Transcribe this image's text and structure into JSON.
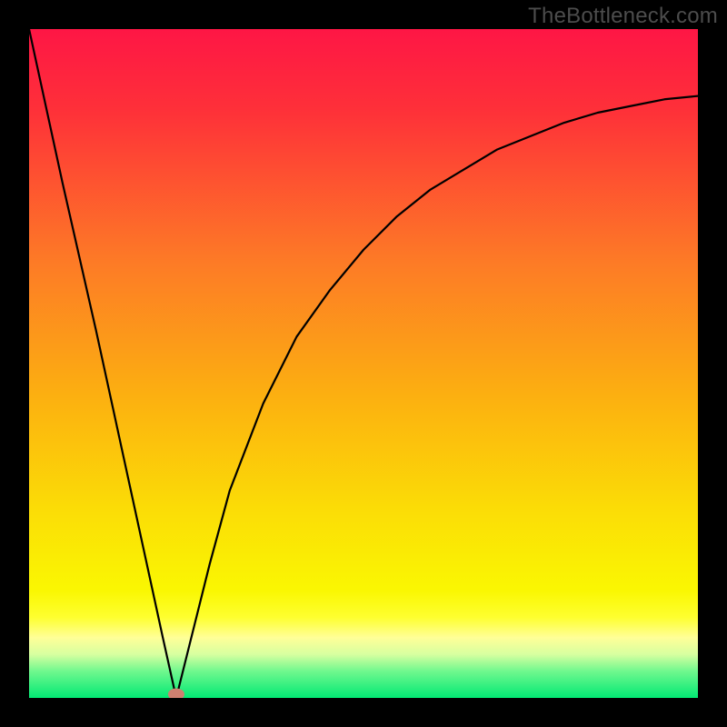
{
  "watermark": "TheBottleneck.com",
  "chart_data": {
    "type": "line",
    "title": "",
    "xlabel": "",
    "ylabel": "",
    "xlim": [
      0,
      100
    ],
    "ylim": [
      0,
      100
    ],
    "min_marker_x": 22,
    "background_gradient": {
      "top": "#fe1645",
      "upper_mid": "#fd7b26",
      "mid": "#fbc80b",
      "lower_mid": "#faf702",
      "bottom_band": "#ffff88",
      "bottom": "#02e974"
    },
    "curve": {
      "note": "Approximate V-shaped curve: steep linear descent from (0,100) to minimum at (22,0), then asymptotic rise toward ~90 at x=100",
      "x": [
        0,
        5,
        10,
        15,
        20,
        22,
        24,
        27,
        30,
        35,
        40,
        45,
        50,
        55,
        60,
        65,
        70,
        75,
        80,
        85,
        90,
        95,
        100
      ],
      "y": [
        100,
        77,
        55,
        32,
        9,
        0,
        8,
        20,
        31,
        44,
        54,
        61,
        67,
        72,
        76,
        79,
        82,
        84,
        86,
        87.5,
        88.5,
        89.5,
        90
      ]
    }
  }
}
